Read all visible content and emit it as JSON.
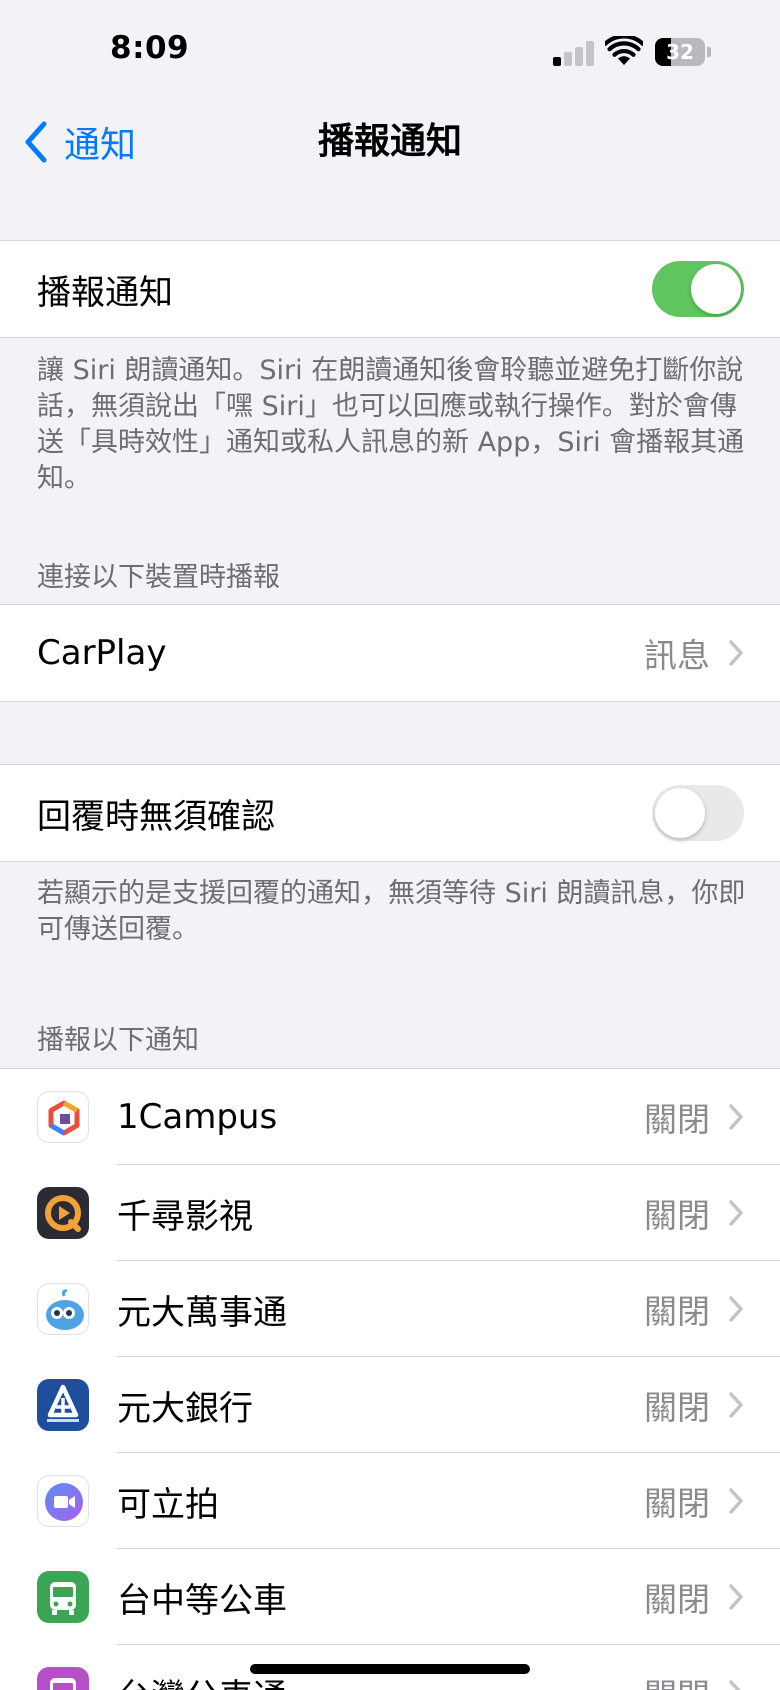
{
  "status_bar": {
    "time": "8:09",
    "battery": "32",
    "battery_level": 0.32,
    "signal_bars_active": 1,
    "signal_bars_total": 4
  },
  "nav": {
    "back_label": "通知",
    "title": "播報通知"
  },
  "announce_toggle": {
    "label": "播報通知",
    "on": true,
    "footer": "讓 Siri 朗讀通知。Siri 在朗讀通知後會聆聽並避免打斷你說話，無須說出「嘿 Siri」也可以回應或執行操作。對於會傳送「具時效性」通知或私人訊息的新 App，Siri 會播報其通知。"
  },
  "devices_section": {
    "header": "連接以下裝置時播報",
    "carplay_label": "CarPlay",
    "carplay_value": "訊息"
  },
  "reply_toggle": {
    "label": "回覆時無須確認",
    "on": false,
    "footer": "若顯示的是支援回覆的通知，無須等待 Siri 朗讀訊息，你即可傳送回覆。"
  },
  "apps_section": {
    "header": "播報以下通知",
    "apps": [
      {
        "name": "1Campus",
        "value": "關閉",
        "icon": "1campus-icon"
      },
      {
        "name": "千尋影視",
        "value": "關閉",
        "icon": "qianxun-icon"
      },
      {
        "name": "元大萬事通",
        "value": "關閉",
        "icon": "yuanta-wanshitong-icon"
      },
      {
        "name": "元大銀行",
        "value": "關閉",
        "icon": "yuanta-bank-icon"
      },
      {
        "name": "可立拍",
        "value": "關閉",
        "icon": "clips-icon"
      },
      {
        "name": "台中等公車",
        "value": "關閉",
        "icon": "taichung-bus-icon"
      },
      {
        "name": "台灣公車通",
        "value": "關閉",
        "icon": "taiwan-bus-icon"
      }
    ]
  },
  "colors": {
    "accent": "#007aff",
    "toggle_on": "#5fc65f",
    "toggle_off": "#e9e9ea",
    "background": "#f2f2f7",
    "secondary_text": "#6d6d72"
  }
}
